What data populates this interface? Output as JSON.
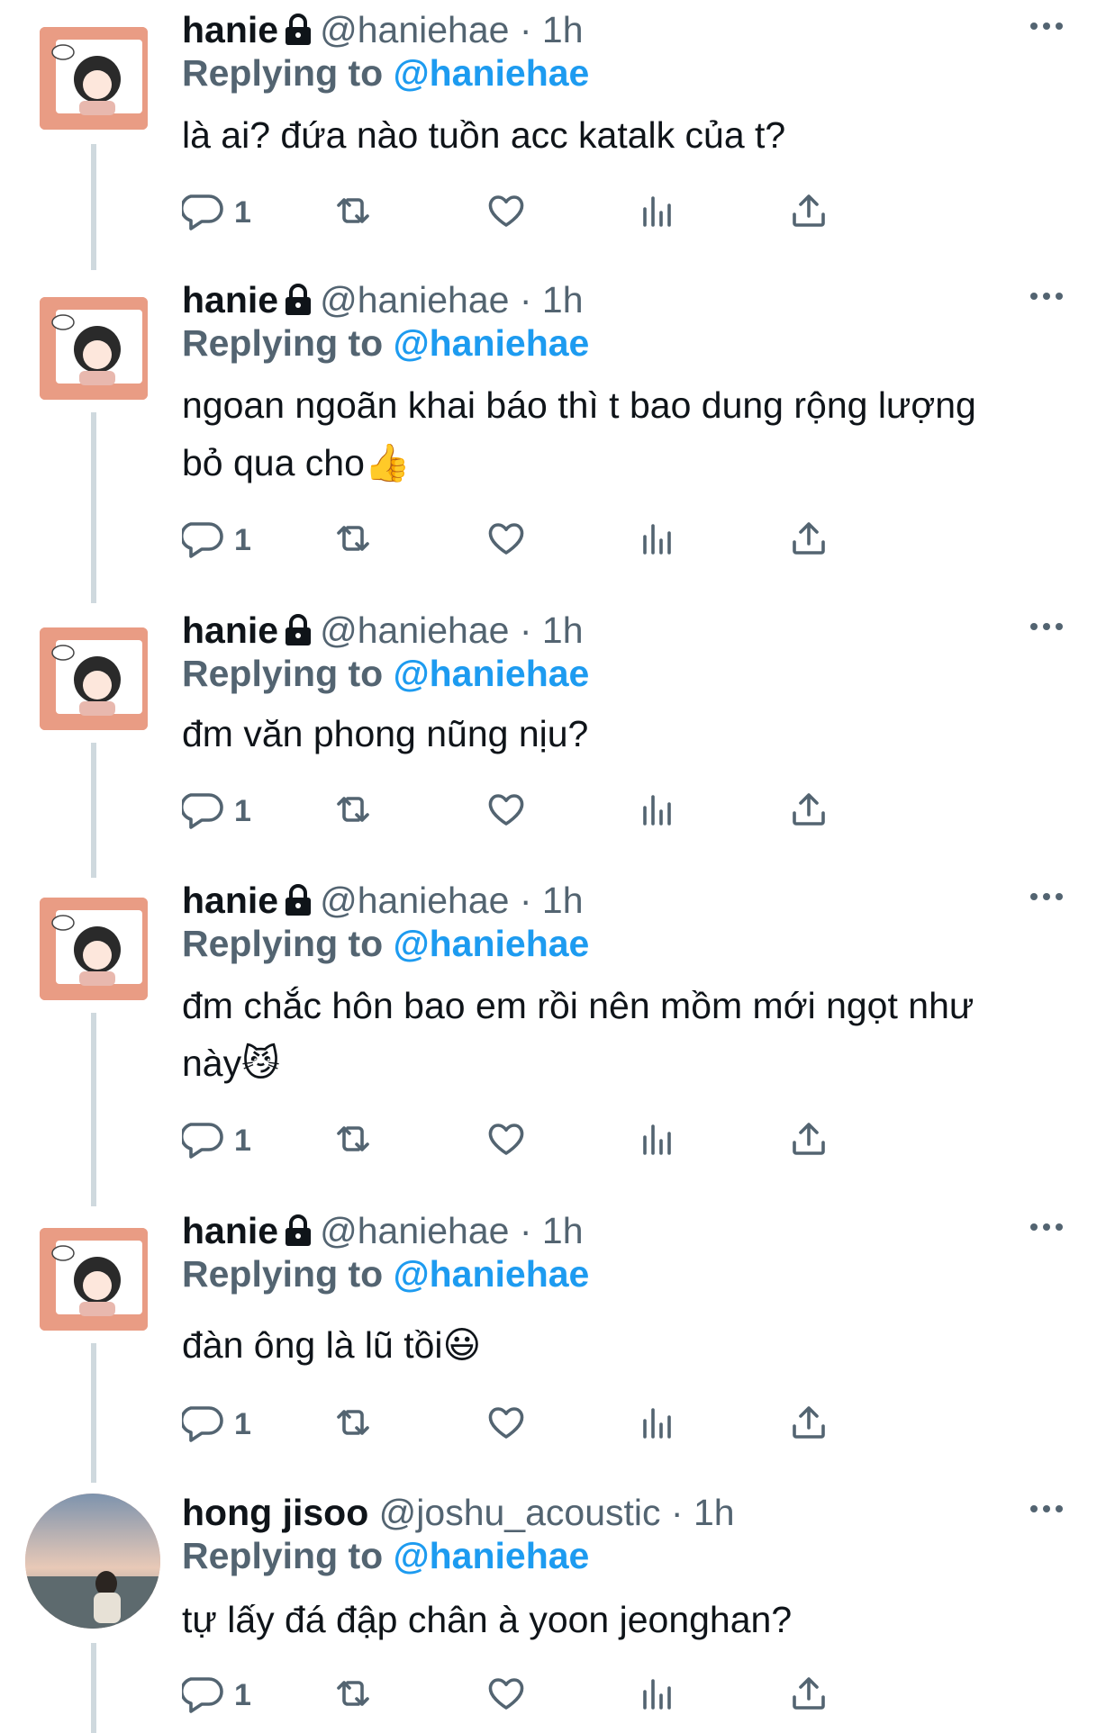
{
  "tweets": [
    {
      "name": "hanie",
      "handle": "@haniehae",
      "time": "1h",
      "replying_label": "Replying to",
      "replying_to": "@haniehae",
      "text": "là ai? đứa nào tuồn acc katalk của t?",
      "reply_count": "1"
    },
    {
      "name": "hanie",
      "handle": "@haniehae",
      "time": "1h",
      "replying_label": "Replying to",
      "replying_to": "@haniehae",
      "text": "ngoan ngoãn khai báo thì t bao dung rộng lượng\nbỏ qua cho👍",
      "reply_count": "1"
    },
    {
      "name": "hanie",
      "handle": "@haniehae",
      "time": "1h",
      "replying_label": "Replying to",
      "replying_to": "@haniehae",
      "text": "đm văn phong nũng nịu?",
      "reply_count": "1"
    },
    {
      "name": "hanie",
      "handle": "@haniehae",
      "time": "1h",
      "replying_label": "Replying to",
      "replying_to": "@haniehae",
      "text": "đm chắc hôn bao em rồi nên mồm mới ngọt như\nnày😼",
      "reply_count": "1"
    },
    {
      "name": "hanie",
      "handle": "@haniehae",
      "time": "1h",
      "replying_label": "Replying to",
      "replying_to": "@haniehae",
      "text": "đàn ông là lũ tồi😃",
      "reply_count": "1"
    },
    {
      "name": "hong jisoo",
      "handle": "@joshu_acoustic",
      "time": "1h",
      "replying_label": "Replying to",
      "replying_to": "@haniehae",
      "text": "tự lấy đá đập chân à yoon jeonghan?",
      "reply_count": "1"
    }
  ],
  "separator": "·",
  "icons": {
    "reply": "reply-bubble-icon",
    "retweet": "retweet-icon",
    "like": "heart-icon",
    "views": "views-bar-icon",
    "share": "share-upload-icon",
    "more": "more-dots-icon",
    "protected": "lock-icon"
  },
  "colors": {
    "text": "#0f1419",
    "muted": "#536471",
    "link": "#1d9bf0",
    "avatar_bg": "#e99c84"
  }
}
